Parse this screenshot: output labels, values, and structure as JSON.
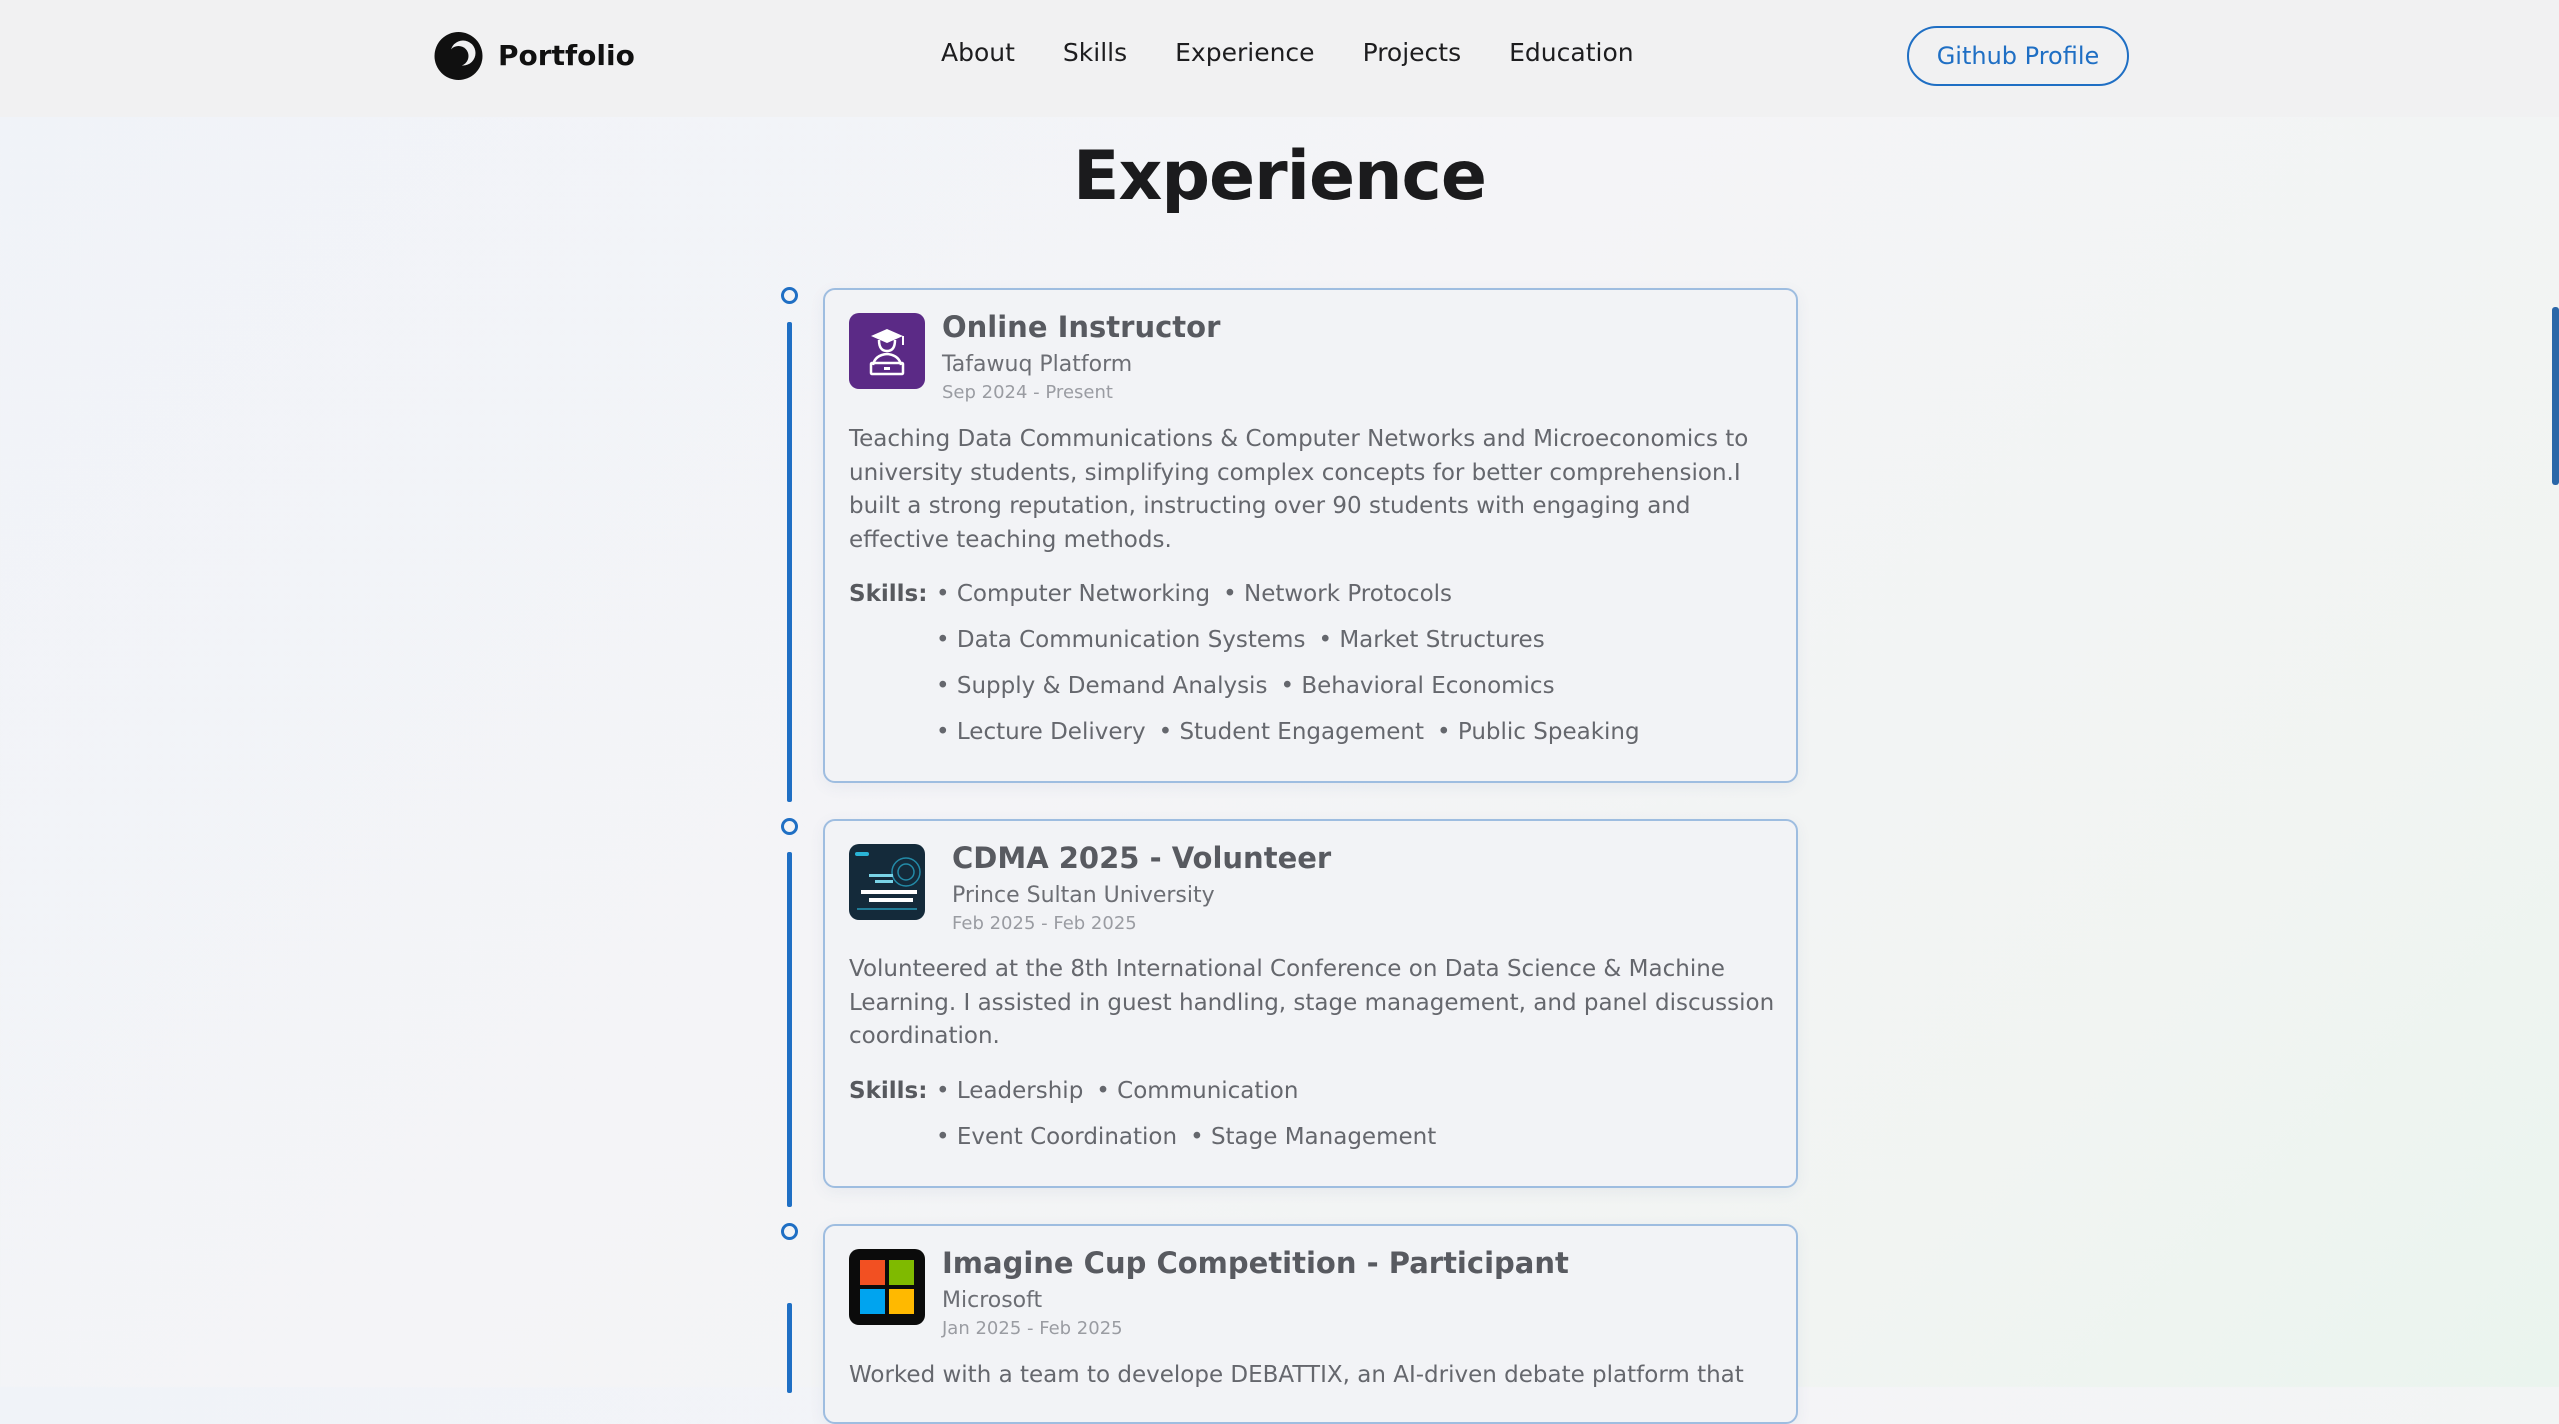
{
  "brand": {
    "name": "Portfolio",
    "logo_icon": "portfolio-logo-icon"
  },
  "nav": {
    "links": [
      {
        "label": "About"
      },
      {
        "label": "Skills"
      },
      {
        "label": "Experience"
      },
      {
        "label": "Projects"
      },
      {
        "label": "Education"
      }
    ],
    "github_button": "Github Profile"
  },
  "section": {
    "title": "Experience"
  },
  "skills_label": "Skills:",
  "accent_color": "#1f6fc4",
  "experiences": [
    {
      "title": "Online Instructor",
      "organization": "Tafawuq Platform",
      "dates": "Sep 2024 - Present",
      "logo_icon": "graduate-teacher-icon",
      "description": "Teaching Data Communications & Computer Networks and Microeconomics to university students, simplifying complex concepts for better comprehension.I built a strong reputation, instructing over 90 students with engaging and effective teaching methods.",
      "skills": [
        "• Computer Networking",
        "• Network Protocols",
        "• Data Communication Systems",
        "• Market Structures",
        "• Supply & Demand Analysis",
        "• Behavioral Economics",
        "• Lecture Delivery",
        "• Student Engagement",
        "• Public Speaking"
      ]
    },
    {
      "title": "CDMA 2025 - Volunteer",
      "organization": "Prince Sultan University",
      "dates": "Feb 2025 - Feb 2025",
      "logo_icon": "conference-poster-icon",
      "description": "Volunteered at the 8th International Conference on Data Science & Machine Learning. I assisted in guest handling, stage management, and panel discussion coordination.",
      "skills": [
        "• Leadership",
        "• Communication",
        "• Event Coordination",
        "• Stage Management"
      ]
    },
    {
      "title": "Imagine Cup Competition - Participant",
      "organization": "Microsoft",
      "dates": "Jan 2025 - Feb 2025",
      "logo_icon": "microsoft-logo-icon",
      "description": "Worked with a team to develope DEBATTIX, an AI-driven debate platform that"
    }
  ]
}
